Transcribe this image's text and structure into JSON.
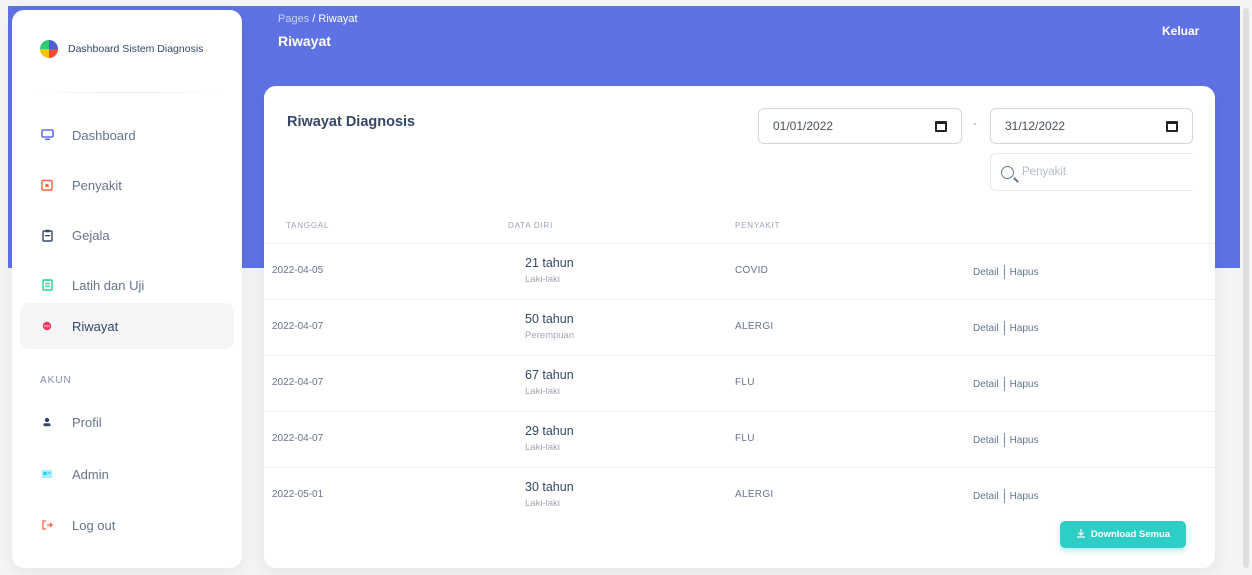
{
  "sidebar": {
    "brand": "Dashboard Sistem Diagnosis",
    "items": [
      {
        "label": "Dashboard",
        "icon": "monitor-icon"
      },
      {
        "label": "Penyakit",
        "icon": "calendar-icon"
      },
      {
        "label": "Gejala",
        "icon": "clipboard-icon"
      },
      {
        "label": "Latih dan Uji",
        "icon": "document-icon"
      },
      {
        "label": "Riwayat",
        "icon": "circle-icon",
        "active": true
      }
    ],
    "section_label": "AKUN",
    "account_items": [
      {
        "label": "Profil",
        "icon": "user-icon"
      },
      {
        "label": "Admin",
        "icon": "id-card-icon"
      },
      {
        "label": "Log out",
        "icon": "logout-icon"
      }
    ]
  },
  "header": {
    "breadcrumb_pages": "Pages",
    "breadcrumb_sep": " / ",
    "breadcrumb_current": "Riwayat",
    "title": "Riwayat",
    "logout": "Keluar"
  },
  "card": {
    "title": "Riwayat Diagnosis",
    "date_from": "01/01/2022",
    "date_separator": "-",
    "date_to": "31/12/2022",
    "search_placeholder": "Penyakit",
    "columns": [
      "TANGGAL",
      "DATA DIRI",
      "PENYAKIT"
    ],
    "rows": [
      {
        "date": "2022-04-05",
        "age": "21 tahun",
        "sex": "Laki-laki",
        "disease": "COVID",
        "detail": "Detail",
        "delete": "Hapus"
      },
      {
        "date": "2022-04-07",
        "age": "50 tahun",
        "sex": "Perempuan",
        "disease": "ALERGI",
        "detail": "Detail",
        "delete": "Hapus"
      },
      {
        "date": "2022-04-07",
        "age": "67 tahun",
        "sex": "Laki-laki",
        "disease": "FLU",
        "detail": "Detail",
        "delete": "Hapus"
      },
      {
        "date": "2022-04-07",
        "age": "29 tahun",
        "sex": "Laki-laki",
        "disease": "FLU",
        "detail": "Detail",
        "delete": "Hapus"
      },
      {
        "date": "2022-05-01",
        "age": "30 tahun",
        "sex": "Laki-laki",
        "disease": "ALERGI",
        "detail": "Detail",
        "delete": "Hapus"
      }
    ],
    "download_label": "Download Semua"
  },
  "colors": {
    "primary": "#5e72e4",
    "download": "#2dcec5",
    "text_dark": "#344767",
    "text_muted": "#67748e"
  }
}
